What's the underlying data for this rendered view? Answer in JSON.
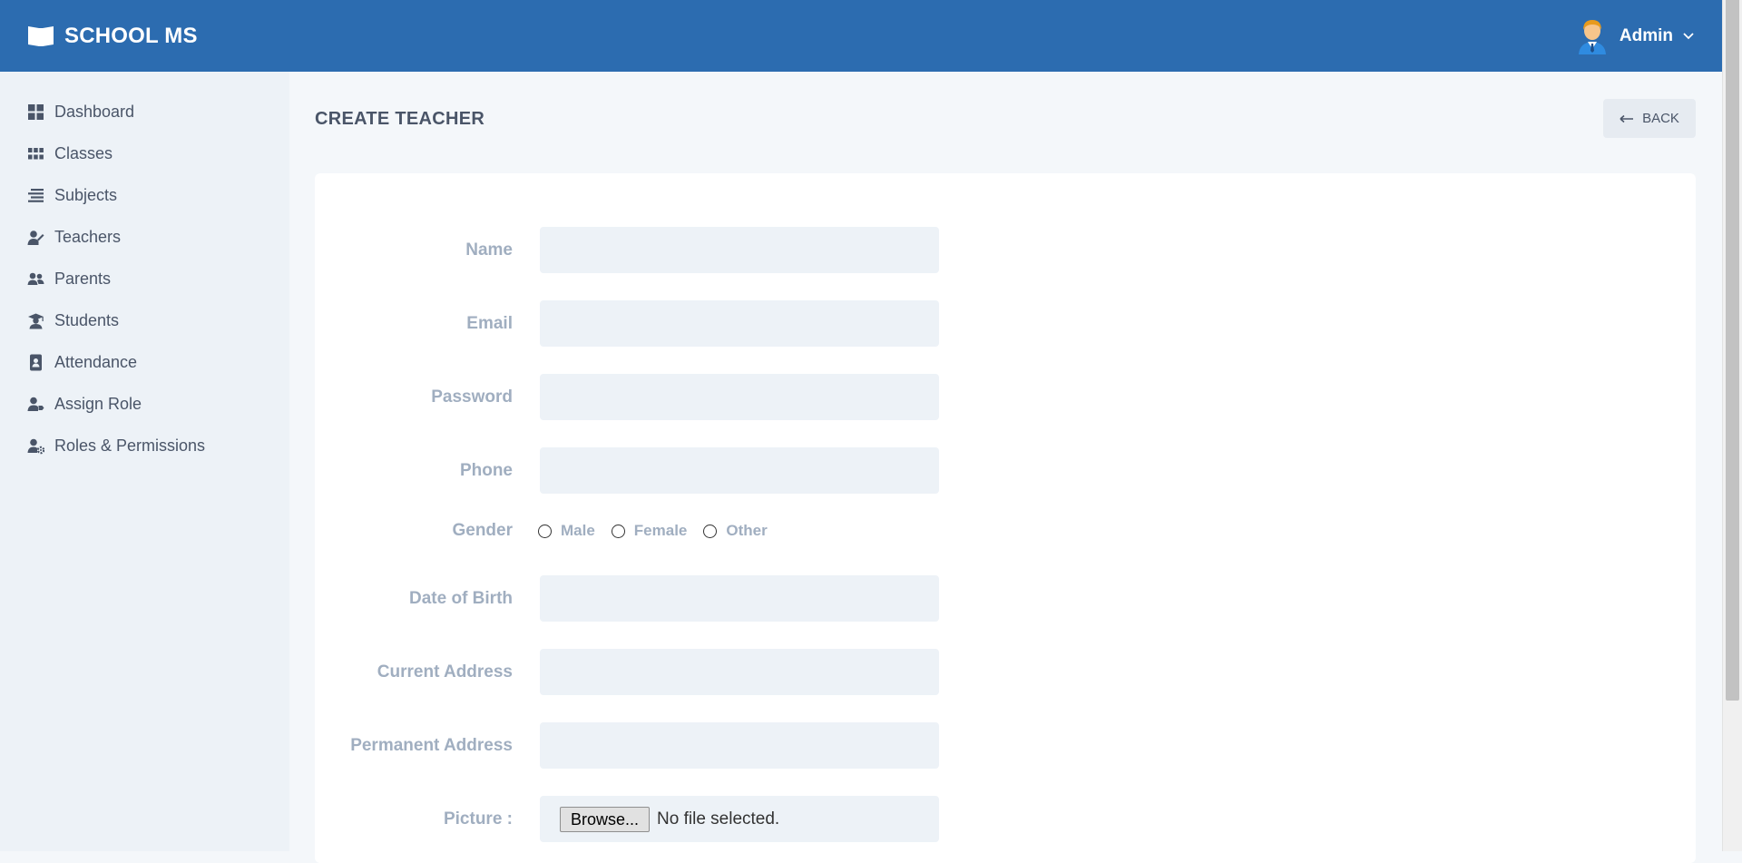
{
  "app": {
    "brand": "SCHOOL MS",
    "user_name": "Admin"
  },
  "colors": {
    "topbar": "#2c6cb0",
    "sidebar_bg": "#edf2f7",
    "page_bg": "#f4f7fa",
    "label": "#a0aec0",
    "text": "#4a5568"
  },
  "sidebar": {
    "items": [
      {
        "label": "Dashboard",
        "icon": "dashboard-icon"
      },
      {
        "label": "Classes",
        "icon": "grid-icon"
      },
      {
        "label": "Subjects",
        "icon": "list-icon"
      },
      {
        "label": "Teachers",
        "icon": "teacher-icon"
      },
      {
        "label": "Parents",
        "icon": "users-icon"
      },
      {
        "label": "Students",
        "icon": "graduation-cap-icon"
      },
      {
        "label": "Attendance",
        "icon": "id-badge-icon"
      },
      {
        "label": "Assign Role",
        "icon": "user-tag-icon"
      },
      {
        "label": "Roles & Permissions",
        "icon": "user-cog-icon"
      }
    ]
  },
  "page": {
    "title": "CREATE TEACHER",
    "back_label": "BACK"
  },
  "form": {
    "name_label": "Name",
    "name_value": "",
    "email_label": "Email",
    "email_value": "",
    "password_label": "Password",
    "password_value": "",
    "phone_label": "Phone",
    "phone_value": "",
    "gender_label": "Gender",
    "gender_options": [
      "Male",
      "Female",
      "Other"
    ],
    "dob_label": "Date of Birth",
    "dob_value": "",
    "current_address_label": "Current Address",
    "current_address_value": "",
    "permanent_address_label": "Permanent Address",
    "permanent_address_value": "",
    "picture_label": "Picture :",
    "browse_label": "Browse...",
    "file_status": "No file selected."
  }
}
